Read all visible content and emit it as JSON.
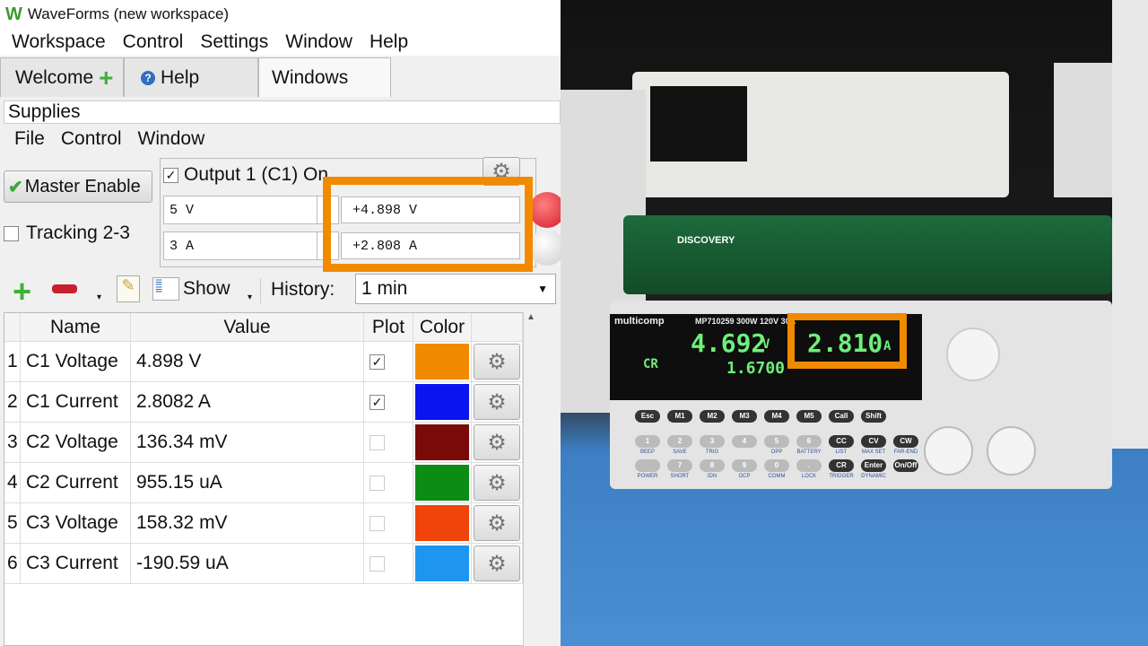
{
  "window": {
    "title": "WaveForms (new workspace)"
  },
  "menubar": [
    "Workspace",
    "Control",
    "Settings",
    "Window",
    "Help"
  ],
  "tabs": [
    {
      "label": "Welcome"
    },
    {
      "label": "Help"
    },
    {
      "label": "Windows"
    }
  ],
  "panel": {
    "title": "Supplies",
    "menu": [
      "File",
      "Control",
      "Window"
    ]
  },
  "master_enable": "Master Enable",
  "tracking": {
    "label": "Tracking 2-3",
    "checked": false
  },
  "output1": {
    "label": "Output 1 (C1) On",
    "checked": true,
    "voltage_set": "5 V",
    "current_set": "3 A",
    "voltage_read": "+4.898 V",
    "current_read": "+2.808 A"
  },
  "toolbar": {
    "show": "Show",
    "history_label": "History:",
    "history_value": "1 min"
  },
  "table": {
    "headers": [
      "Name",
      "Value",
      "Plot",
      "Color"
    ],
    "rows": [
      {
        "n": "1",
        "name": "C1 Voltage",
        "value": "4.898 V",
        "plot": true,
        "color": "#f28a00"
      },
      {
        "n": "2",
        "name": "C1 Current",
        "value": "2.8082 A",
        "plot": true,
        "color": "#0a14f0"
      },
      {
        "n": "3",
        "name": "C2 Voltage",
        "value": "136.34 mV",
        "plot": false,
        "color": "#7a0a0a"
      },
      {
        "n": "4",
        "name": "C2 Current",
        "value": "955.15 uA",
        "plot": false,
        "color": "#0c8c14"
      },
      {
        "n": "5",
        "name": "C3 Voltage",
        "value": "158.32 mV",
        "plot": false,
        "color": "#f0440a"
      },
      {
        "n": "6",
        "name": "C3 Current",
        "value": "-190.59 uA",
        "plot": false,
        "color": "#1e96f0"
      }
    ]
  },
  "photo": {
    "brand": "multicomp",
    "model": "MP710259  300W  120V 30A",
    "device": "DISCOVERY",
    "voltage": "4.692",
    "voltage_unit": "V",
    "current": "2.810",
    "current_unit": "A",
    "mode": "CR",
    "setting": "1.6700",
    "keys_top": [
      "Esc",
      "M1",
      "M2",
      "M3",
      "M4",
      "M5",
      "Call",
      "Shift"
    ],
    "keys_num": [
      "1",
      "2",
      "3",
      "4",
      "5",
      "6",
      "CC",
      "CV",
      "CW"
    ],
    "labels_num": [
      "BEEP",
      "SAVE",
      "TRIG",
      "",
      "OPP",
      "BATTERY",
      "LIST",
      "MAX SET",
      "FAR-END"
    ],
    "keys_bot": [
      "",
      "7",
      "8",
      "9",
      "0",
      ".",
      "CR",
      "Enter",
      "On/Off"
    ],
    "labels_bot": [
      "POWER",
      "SHORT",
      "IDN",
      "OCP",
      "COMM",
      "LOCK",
      "TRIGGER",
      "DYNAMIC",
      ""
    ],
    "highlight_color": "#f28a00"
  }
}
